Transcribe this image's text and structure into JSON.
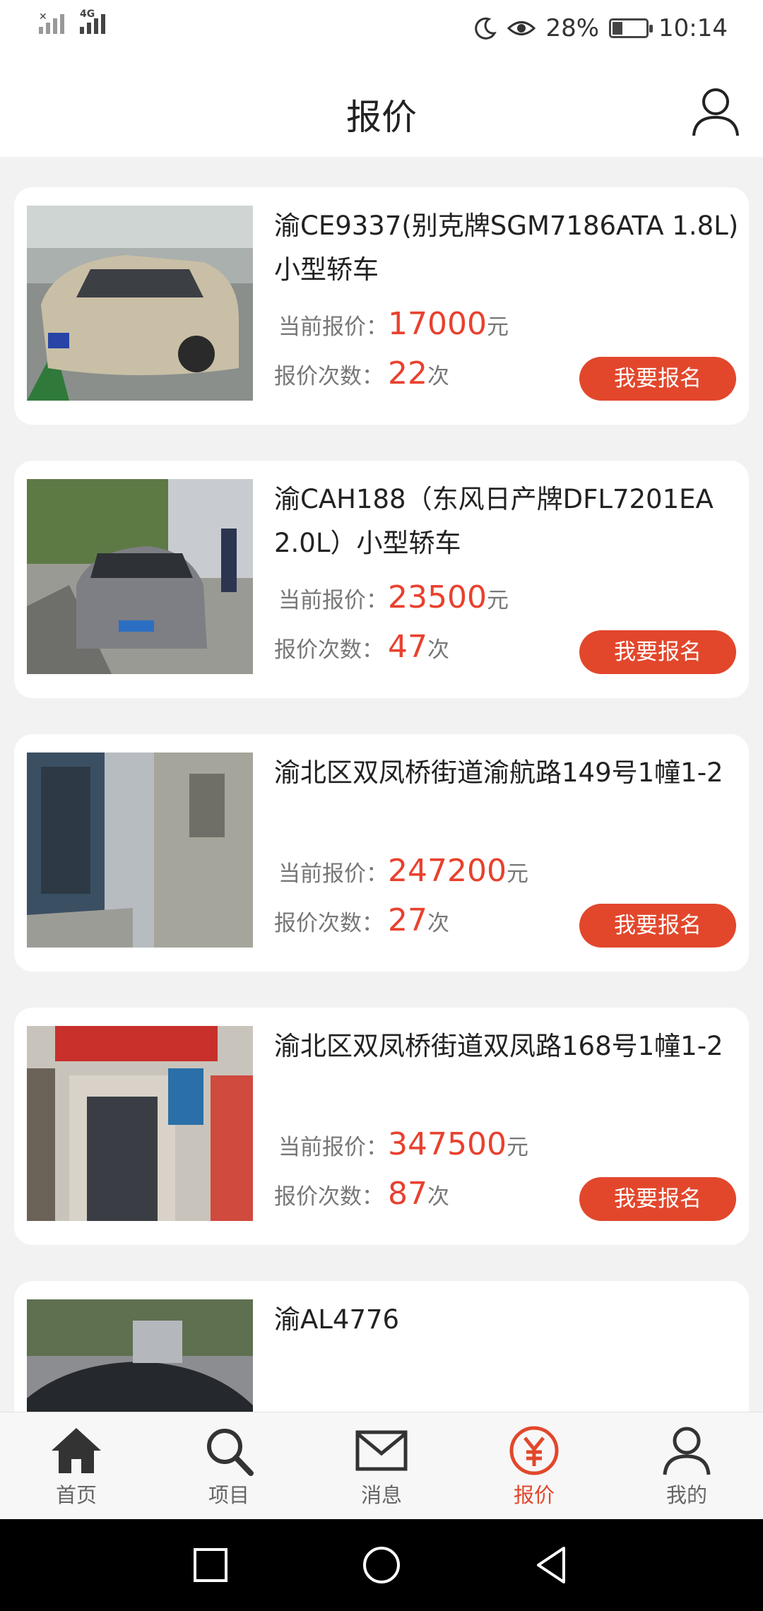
{
  "status_bar": {
    "signal_type": "4G",
    "battery_percent": "28%",
    "battery_level": 0.28,
    "time": "10:14"
  },
  "header": {
    "title": "报价"
  },
  "labels": {
    "current_price": "当前报价：",
    "bid_count": "报价次数：",
    "yuan": "元",
    "times": "次",
    "signup": "我要报名"
  },
  "items": [
    {
      "title": "渝CE9337(别克牌SGM7186ATA 1.8L)小型轿车",
      "price": "17000",
      "count": "22"
    },
    {
      "title": "渝CAH188（东风日产牌DFL7201EA 2.0L）小型轿车",
      "price": "23500",
      "count": "47"
    },
    {
      "title": "渝北区双凤桥街道渝航路149号1幢1-2",
      "price": "247200",
      "count": "27"
    },
    {
      "title": "渝北区双凤桥街道双凤路168号1幢1-2",
      "price": "347500",
      "count": "87"
    },
    {
      "title": "渝AL4776",
      "price": "",
      "count": ""
    }
  ],
  "tabs": [
    {
      "label": "首页",
      "icon": "home-icon"
    },
    {
      "label": "项目",
      "icon": "search-icon"
    },
    {
      "label": "消息",
      "icon": "mail-icon"
    },
    {
      "label": "报价",
      "icon": "yen-icon",
      "active": true
    },
    {
      "label": "我的",
      "icon": "user-icon"
    }
  ],
  "colors": {
    "accent": "#e2472c",
    "price": "#e8412e"
  }
}
